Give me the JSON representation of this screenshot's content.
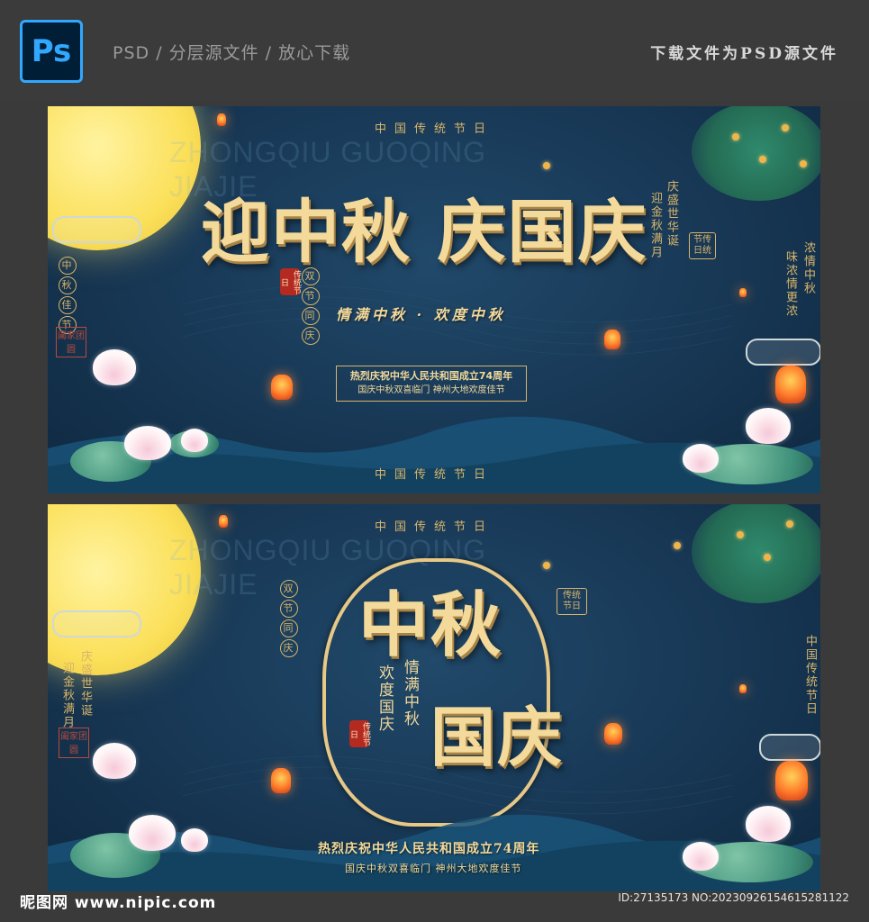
{
  "header": {
    "ps_logo": "Ps",
    "caption": "PSD / 分层源文件 / 放心下载",
    "right_caption": "下载文件为PSD源文件"
  },
  "banner1": {
    "top_tag": "中国传统节日",
    "bottom_tag": "中国传统节日",
    "watermark": "ZHONGQIU  GUOQING\nJIAJIE",
    "main_title": "迎中秋 庆国庆",
    "subtitle": "情满中秋 · 欢度中秋",
    "box_line1": "热烈庆祝中华人民共和国成立74周年",
    "box_line2": "国庆中秋双喜临门  神州大地欢度佳节",
    "left_circles": [
      "中",
      "秋",
      "佳",
      "节"
    ],
    "seal_square": "阖家团圆",
    "double_festival": [
      "双",
      "节",
      "同",
      "庆"
    ],
    "seal_red": "传统节日",
    "right_vert1": "庆盛世华诞",
    "right_vert2": "迎金秋满月",
    "box_tag": "节传日统",
    "right_vert3": "浓情中秋",
    "right_vert4": "味浓情更浓"
  },
  "banner2": {
    "top_tag": "中国传统节日",
    "watermark": "ZHONGQIU  GUOQING\nJIAJIE",
    "main_title_a": "中秋",
    "main_title_b": "国庆",
    "side_col1": "情满中秋",
    "side_col2": "欢度国庆",
    "double_festival": [
      "双",
      "节",
      "同",
      "庆"
    ],
    "seal_red": "传统节日",
    "left_vert1": "庆盛世华诞",
    "left_vert2": "迎金秋满月",
    "seal_square": "阖家团圆",
    "box_tag": "传统节日",
    "right_vert": "中国传统节日",
    "bottom_line1": "热烈庆祝中华人民共和国成立74周年",
    "bottom_line2": "国庆中秋双喜临门  神州大地欢度佳节"
  },
  "footer": {
    "site": "昵图网 www.nipic.com",
    "id_text": "ID:27135173 NO:20230926154615281122"
  },
  "colors": {
    "background": "#3a3a3a",
    "banner_blue": "#173754",
    "gold": "#d8b46a",
    "moon": "#fbe05a",
    "ps_blue": "#31a8ff"
  }
}
